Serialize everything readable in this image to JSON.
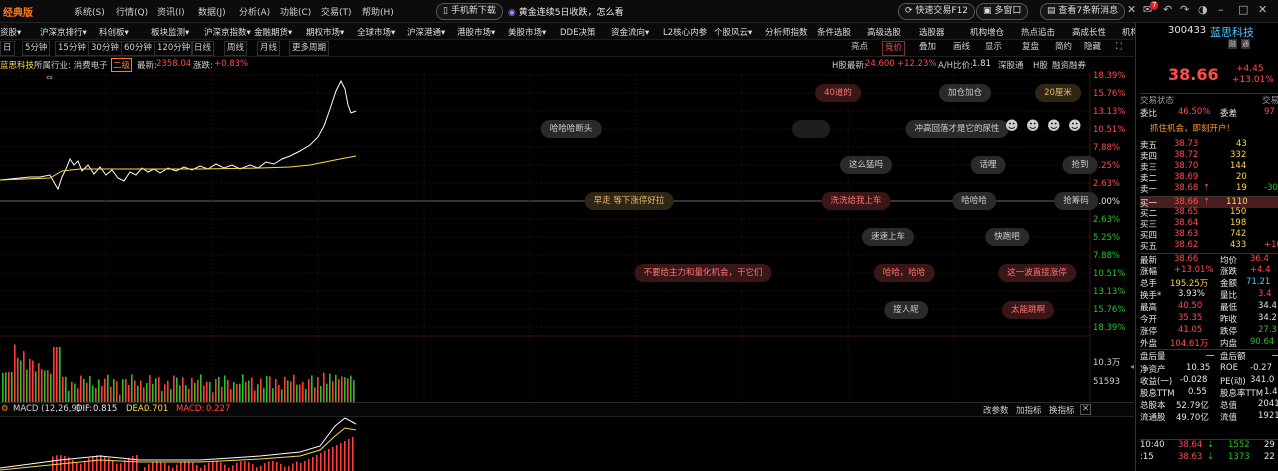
{
  "menubar": {
    "logo": "经典版",
    "items": [
      "系统(S)",
      "行情(Q)",
      "资讯(I)",
      "数据(J)",
      "分析(A)",
      "功能(C)",
      "交易(T)",
      "帮助(H)"
    ],
    "download_label": "手机新下载",
    "news_headline": "黄金连续5日收跌，怎么看",
    "quick_trade": "快速交易F12",
    "multi_window": "多窗口",
    "messages": "查看7条新消息",
    "badge": "7",
    "open_file": "打开导航"
  },
  "nav2": [
    "资股▾",
    "沪深京排行▾",
    "科创板▾",
    "板块监测▾",
    "沪深京指数▾",
    "金融期货▾",
    "期权市场▾",
    "全球市场▾",
    "沪深港通▾",
    "港股市场▾",
    "美股市场▾",
    "DDE决策",
    "资金流向▾",
    "L2核心内参",
    "个股风云▾",
    "分析师指数",
    "条件选股",
    "高级选股",
    "选股器",
    "机构增仓",
    "热点追击",
    "高成长性",
    "机构推荐"
  ],
  "nav3": {
    "periods": [
      "日",
      "5分钟",
      "15分钟",
      "30分钟",
      "60分钟",
      "120分钟",
      "日线",
      "周线",
      "月线",
      "更多周期"
    ],
    "right": [
      "亮点",
      "竞价",
      "叠加",
      "画线",
      "显示",
      "复盘",
      "简约",
      "隐藏"
    ]
  },
  "info": {
    "stock": "蓝思科技",
    "industry_label": "所属行业: 消费电子",
    "grade": "二级",
    "latest_label": "最新:",
    "latest": "2358.04",
    "change_label": "涨跌:",
    "change": "+0.83%",
    "h_label": "H股最新:",
    "h_price": "24.600",
    "h_pct": "+12.23%",
    "ah_label": "A/H比价:",
    "ah_ratio": "1.81",
    "link1": "深股通",
    "link2": "H股",
    "link3": "融资融券"
  },
  "axis": {
    "right_pct": [
      "18.39%",
      "15.76%",
      "13.13%",
      "10.51%",
      "7.88%",
      "5.25%",
      "2.63%",
      "0.00%",
      "2.63%",
      "5.25%",
      "7.88%",
      "10.51%",
      "13.13%",
      "15.76%",
      "18.39%"
    ],
    "vol_labels": [
      "10.3万",
      "51593"
    ]
  },
  "barrage": [
    {
      "text": "40道的",
      "style": "r"
    },
    {
      "text": "加仓加仓",
      "style": "g"
    },
    {
      "text": "20厘米",
      "style": "o"
    },
    {
      "text": "哈哈哈断头",
      "style": "g"
    },
    {
      "text": "",
      "style": "f"
    },
    {
      "text": "冲高回落才是它的尿性",
      "style": "g"
    },
    {
      "text": "这么猛吗",
      "style": "g"
    },
    {
      "text": "话哩",
      "style": "g"
    },
    {
      "text": "抢到",
      "style": "g"
    },
    {
      "text": "早走 等下涨停好拉",
      "style": "o"
    },
    {
      "text": "洗洗给我上车",
      "style": "r"
    },
    {
      "text": "哈哈哈",
      "style": "g"
    },
    {
      "text": "抢筹码",
      "style": "g"
    },
    {
      "text": "速速上车",
      "style": "g"
    },
    {
      "text": "快跑吧",
      "style": "g"
    },
    {
      "text": "不要给主力和量化机会，干它们",
      "style": "r"
    },
    {
      "text": "哈哈，哈哈",
      "style": "r"
    },
    {
      "text": "这一波直接涨停",
      "style": "r"
    },
    {
      "text": "接人呢",
      "style": "g"
    },
    {
      "text": "太能跳啊",
      "style": "r"
    }
  ],
  "macd": {
    "label": "MACD (12,26,9)",
    "dif_label": "DIF:",
    "dif": "0.815",
    "dea_label": "DEA:",
    "dea": "0.701",
    "macd_label": "MACD:",
    "macd": "0.227",
    "actions": [
      "改参数",
      "加指标",
      "换指标"
    ]
  },
  "quote": {
    "code": "300433",
    "name": "蓝思科技",
    "tag1": "融",
    "tag2": "通",
    "price": "38.66",
    "change": "+4.45",
    "change_pct": "+13.01%",
    "status_label": "交易状态",
    "status_right": "交易",
    "ratio_label": "委比",
    "ratio": "46.50%",
    "diff_label": "委差",
    "diff": "97",
    "promo": "抓住机会，即刻开户!",
    "asks": [
      {
        "label": "卖五",
        "price": "38.73",
        "vol": "43"
      },
      {
        "label": "卖四",
        "price": "38.72",
        "vol": "332"
      },
      {
        "label": "卖三",
        "price": "38.70",
        "vol": "144"
      },
      {
        "label": "卖二",
        "price": "38.69",
        "vol": "20"
      },
      {
        "label": "卖一",
        "price": "38.68",
        "vol": "19",
        "extra": "-30"
      }
    ],
    "bids": [
      {
        "label": "买一",
        "price": "38.66",
        "vol": "1110"
      },
      {
        "label": "买二",
        "price": "38.65",
        "vol": "150"
      },
      {
        "label": "买三",
        "price": "38.64",
        "vol": "198"
      },
      {
        "label": "买四",
        "price": "38.63",
        "vol": "742"
      },
      {
        "label": "买五",
        "price": "38.62",
        "vol": "433",
        "extra": "+10"
      }
    ],
    "stats": [
      {
        "l1": "最新",
        "v1": "38.66",
        "l2": "均价",
        "v2": "36.4"
      },
      {
        "l1": "涨幅",
        "v1": "+13.01%",
        "l2": "涨跌",
        "v2": "+4.4"
      },
      {
        "l1": "总手",
        "v1": "195.25万",
        "l2": "金额",
        "v2": "71.21"
      },
      {
        "l1": "换手*",
        "v1": "3.93%",
        "l2": "量比",
        "v2": "3.4"
      },
      {
        "l1": "最高",
        "v1": "40.50",
        "l2": "最低",
        "v2": "34.4"
      },
      {
        "l1": "今开",
        "v1": "35.35",
        "l2": "昨收",
        "v2": "34.2"
      },
      {
        "l1": "涨停",
        "v1": "41.05",
        "l2": "跌停",
        "v2": "27.3"
      },
      {
        "l1": "外盘",
        "v1": "104.61万",
        "l2": "内盘",
        "v2": "90.64"
      },
      {
        "l1": "盘后量",
        "v1": "一",
        "l2": "盘后额",
        "v2": "一"
      },
      {
        "l1": "净资产",
        "v1": "10.35",
        "l2": "ROE",
        "v2": "-0.27"
      },
      {
        "l1": "收益(一)",
        "v1": "-0.028",
        "l2": "PE(动)",
        "v2": "341.0"
      },
      {
        "l1": "股息TTM",
        "v1": "0.55",
        "l2": "股息率TTM",
        "v2": "1.42"
      },
      {
        "l1": "总股本",
        "v1": "52.79亿",
        "l2": "总值",
        "v2": "2041"
      },
      {
        "l1": "流通股",
        "v1": "49.70亿",
        "l2": "流值",
        "v2": "1921"
      }
    ],
    "ticks": [
      {
        "time": "10:40",
        "price": "38.64",
        "vol": "1552",
        "extra": "29"
      },
      {
        "time": ":15",
        "price": "38.63",
        "vol": "1373",
        "extra": "22"
      }
    ]
  },
  "colors": {
    "up": "#ff4c4c",
    "down": "#27c227",
    "price_line": "#ffffff",
    "avg_line": "#ffd84a",
    "grid": "#2a0d0d"
  }
}
